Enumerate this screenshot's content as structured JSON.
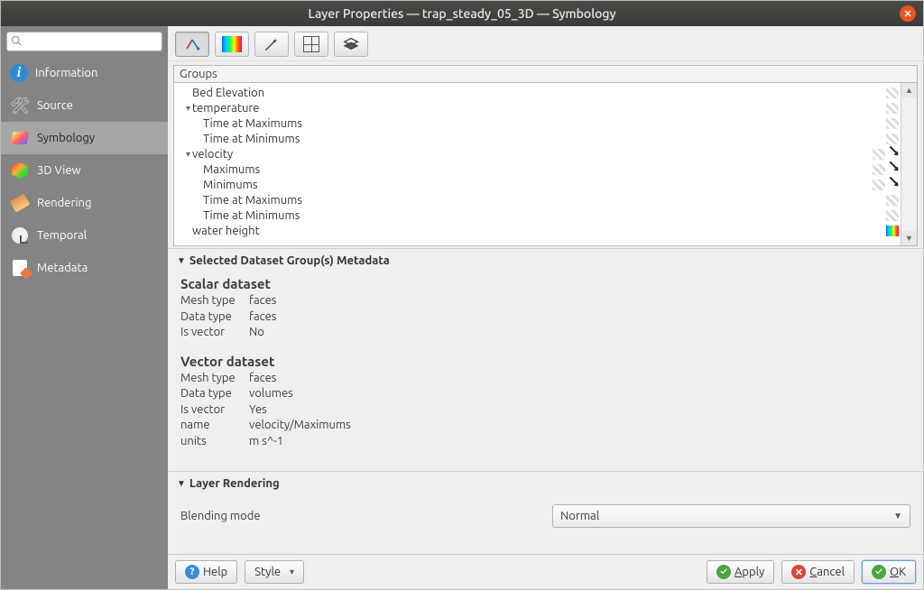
{
  "window": {
    "title": "Layer Properties — trap_steady_05_3D — Symbology"
  },
  "sidebar": {
    "search_placeholder": "",
    "items": [
      {
        "label": "Information"
      },
      {
        "label": "Source"
      },
      {
        "label": "Symbology"
      },
      {
        "label": "3D View"
      },
      {
        "label": "Rendering"
      },
      {
        "label": "Temporal"
      },
      {
        "label": "Metadata"
      }
    ]
  },
  "groups": {
    "header": "Groups",
    "tree": [
      {
        "label": "Bed Elevation",
        "level": 0
      },
      {
        "label": "temperature",
        "level": 0,
        "expanded": true
      },
      {
        "label": "Time at Maximums",
        "level": 1
      },
      {
        "label": "Time at Minimums",
        "level": 1
      },
      {
        "label": "velocity",
        "level": 0,
        "expanded": true
      },
      {
        "label": "Maximums",
        "level": 1
      },
      {
        "label": "Minimums",
        "level": 1
      },
      {
        "label": "Time at Maximums",
        "level": 1
      },
      {
        "label": "Time at Minimums",
        "level": 1
      },
      {
        "label": "water  height",
        "level": 0
      }
    ]
  },
  "metadata_section": {
    "title": "Selected Dataset Group(s) Metadata",
    "scalar": {
      "heading": "Scalar dataset",
      "rows": [
        {
          "k": "Mesh type",
          "v": "faces"
        },
        {
          "k": "Data type",
          "v": "faces"
        },
        {
          "k": "Is vector",
          "v": "No"
        }
      ]
    },
    "vector": {
      "heading": "Vector dataset",
      "rows": [
        {
          "k": "Mesh type",
          "v": "faces"
        },
        {
          "k": "Data type",
          "v": "volumes"
        },
        {
          "k": "Is vector",
          "v": "Yes"
        },
        {
          "k": "name",
          "v": "velocity/Maximums"
        },
        {
          "k": "units",
          "v": "m s^-1"
        }
      ]
    }
  },
  "layer_rendering": {
    "title": "Layer Rendering",
    "blend_label": "Blending mode",
    "blend_value": "Normal"
  },
  "buttons": {
    "help": "Help",
    "style": "Style",
    "apply": "Apply",
    "cancel": "Cancel",
    "ok": "OK"
  }
}
